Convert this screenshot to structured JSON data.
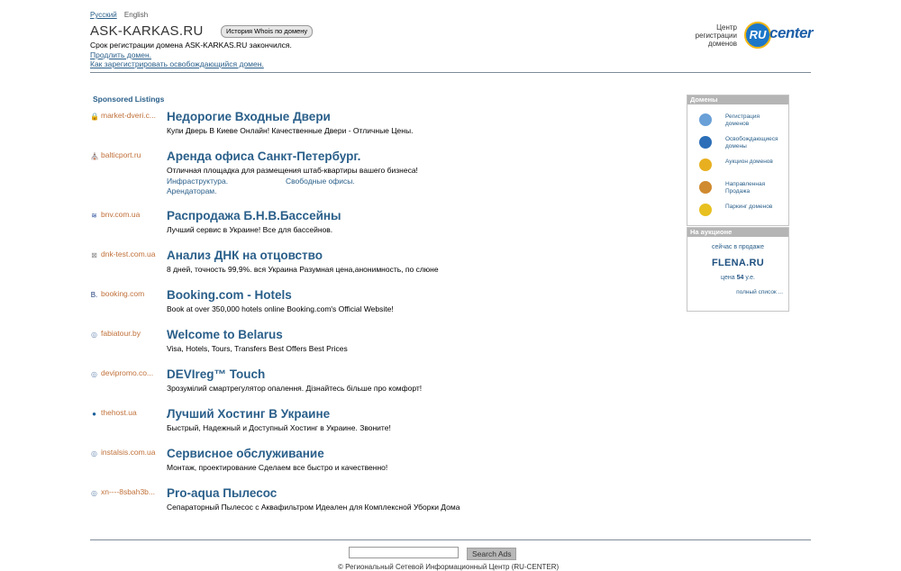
{
  "header": {
    "lang_ru": "Русский",
    "lang_en": "English",
    "domain": "ASK-KARKAS.RU",
    "whois_button": "История Whois по домену",
    "expired_text": "Срок регистрации домена ASK-KARKAS.RU закончился.",
    "renew_link": "Продлить домен.",
    "register_link": "Как зарегистрировать освобождающийся домен."
  },
  "logo": {
    "line1": "Центр",
    "line2": "регистрации",
    "line3": "доменов",
    "badge": "RU",
    "word": "center"
  },
  "sponsored": {
    "title": "Sponsored Listings",
    "items": [
      {
        "source": "market-dveri.c...",
        "icon": "🔒",
        "icon_color": "#c0703a",
        "title": "Недорогие Входные Двери",
        "desc": "Купи Дверь В Киеве Онлайн! Качественные Двери - Отличные Цены."
      },
      {
        "source": "balticport.ru",
        "icon": "⛪",
        "icon_color": "#b03030",
        "title": "Аренда офиса Санкт-Петербург.",
        "desc": "Отличная площадка для размещения штаб-квартиры вашего бизнеса!",
        "sublinks": [
          [
            "Инфраструктура.",
            "Свободные офисы."
          ],
          [
            "Арендаторам.",
            ""
          ]
        ]
      },
      {
        "source": "bnv.com.ua",
        "icon": "≋",
        "icon_color": "#2a4f9a",
        "title": "Распродажа Б.Н.В.Бассейны",
        "desc": "Лучший сервис в Украине! Все для бассейнов."
      },
      {
        "source": "dnk-test.com.ua",
        "icon": "⊠",
        "icon_color": "#888888",
        "title": "Анализ ДНК на отцовство",
        "desc": "8 дней, точность 99,9%. вся Украина Разумная цена,анонимность, по слюне"
      },
      {
        "source": "booking.com",
        "icon": "B.",
        "icon_color": "#1e3d7a",
        "title": "Booking.com - Hotels",
        "desc": "Book at over 350,000 hotels online Booking.com's Official Website!"
      },
      {
        "source": "fabiatour.by",
        "icon": "◎",
        "icon_color": "#6a8ab0",
        "title": "Welcome to Belarus",
        "desc": "Visa, Hotels, Tours, Transfers Best Offers Best Prices"
      },
      {
        "source": "devipromo.co...",
        "icon": "◎",
        "icon_color": "#6a8ab0",
        "title": "DEVIreg™ Touch",
        "desc": "Зрозумілий смартрегулятор опалення. Дізнайтесь більше про комфорт!"
      },
      {
        "source": "thehost.ua",
        "icon": "●",
        "icon_color": "#1e5f9a",
        "title": "Лучший Хостинг В Украине",
        "desc": "Быстрый, Надежный и Доступный Хостинг в Украине. Звоните!"
      },
      {
        "source": "instalsis.com.ua",
        "icon": "◎",
        "icon_color": "#6a8ab0",
        "title": "Сервисное обслуживание",
        "desc": "Монтаж, проектирование Сделаем все быстро и качественно!"
      },
      {
        "source": "xn----8sbah3b...",
        "icon": "◎",
        "icon_color": "#6a8ab0",
        "title": "Pro-aqua Пылесос",
        "desc": "Сепараторный Пылесос с Аквафильтром Идеален для Комплексной Уборки Дома"
      }
    ]
  },
  "sidebar": {
    "domains_title": "Домены",
    "domains": [
      {
        "l1": "Регистрация",
        "l2": "доменов",
        "color": "#6aa0d8",
        "name": "register-globe-icon"
      },
      {
        "l1": "Освобождающиеся",
        "l2": "домены",
        "color": "#2c6fb8",
        "name": "ru-wings-icon"
      },
      {
        "l1": "Аукцион доменов",
        "l2": "",
        "color": "#e8b020",
        "name": "auction-coin-icon"
      },
      {
        "l1": "Направленная",
        "l2": "Продажа",
        "color": "#d08a30",
        "name": "direct-sale-icon"
      },
      {
        "l1": "Паркинг доменов",
        "l2": "",
        "color": "#e8c020",
        "name": "parking-icon"
      }
    ],
    "auction_title": "На аукционе",
    "auction_now": "сейчас в продаже",
    "auction_domain": "FLENA.RU",
    "price_prefix": "цена",
    "price_value": "54",
    "price_suffix": "у.е.",
    "full_list": "полный список ..."
  },
  "footer": {
    "search_button": "Search Ads",
    "copyright": "© Региональный Сетевой Информационный Центр (RU-CENTER)"
  }
}
